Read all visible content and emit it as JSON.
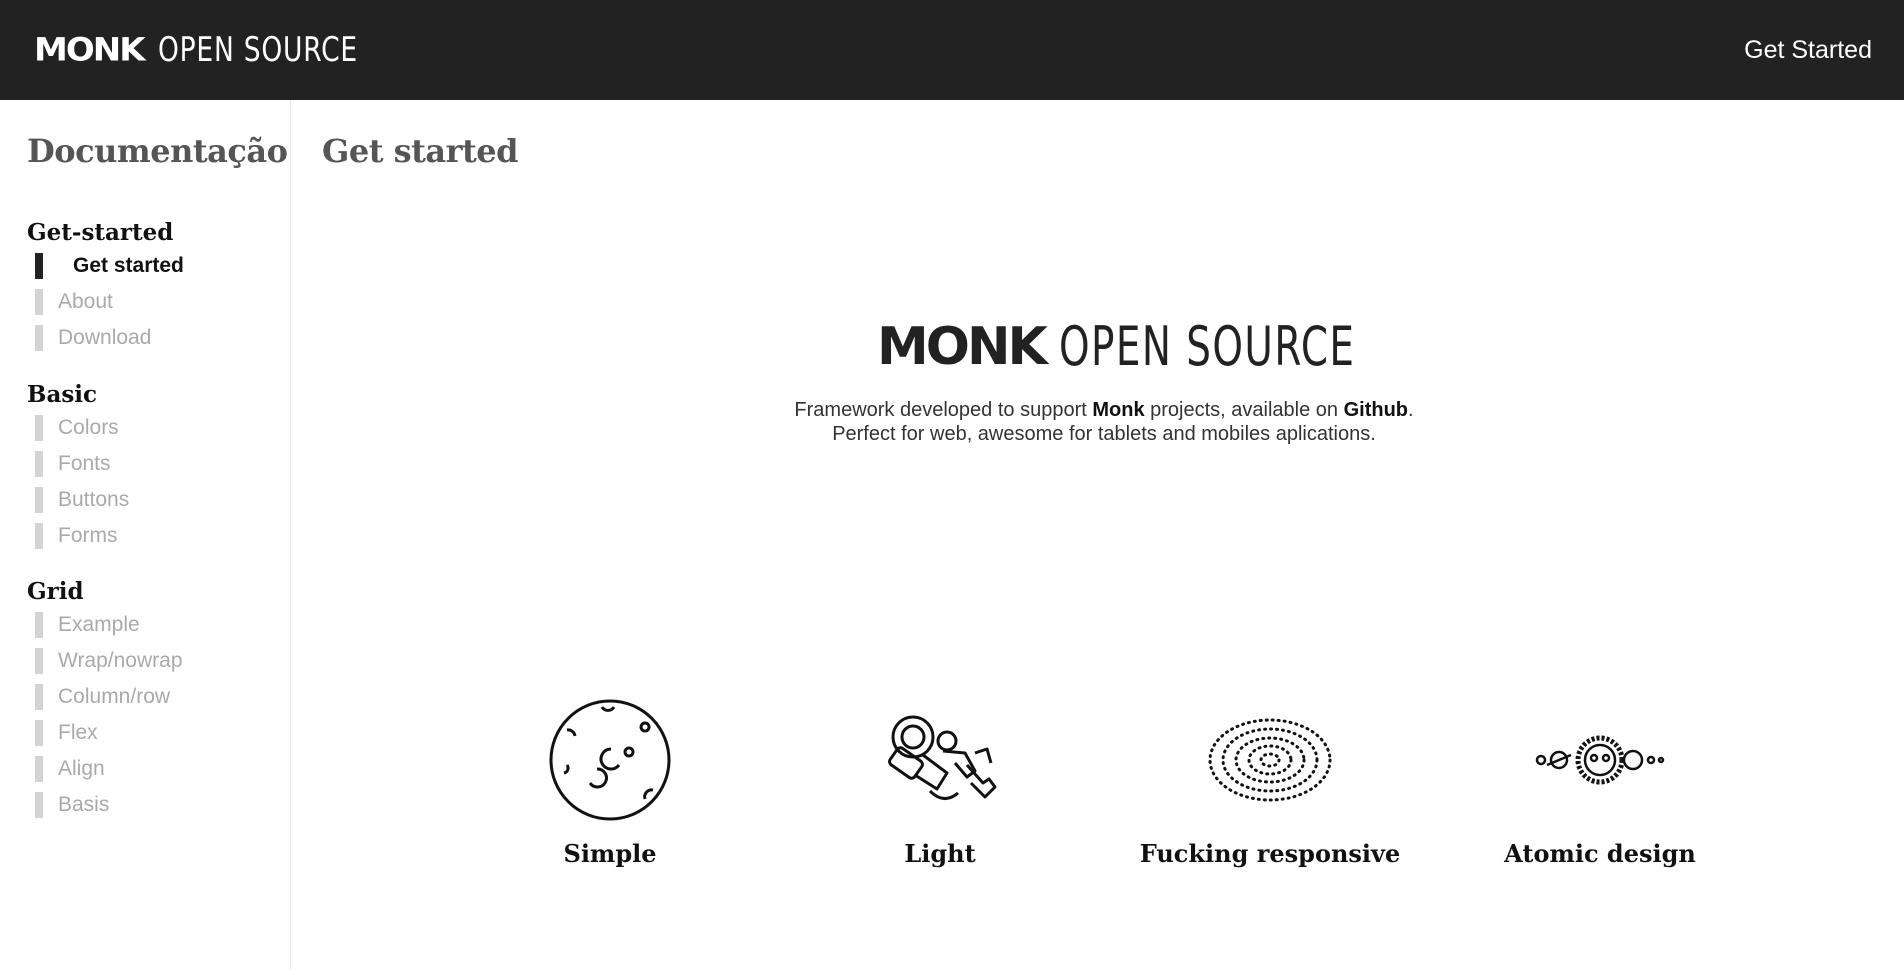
{
  "header": {
    "brand_monk": "MONK",
    "brand_open_source": "OPEN SOURCE",
    "get_started_link": "Get Started"
  },
  "sidebar": {
    "title": "Documentação",
    "groups": [
      {
        "title": "Get-started",
        "items": [
          {
            "label": "Get started",
            "active": true
          },
          {
            "label": "About"
          },
          {
            "label": "Download"
          }
        ]
      },
      {
        "title": "Basic",
        "items": [
          {
            "label": "Colors"
          },
          {
            "label": "Fonts"
          },
          {
            "label": "Buttons"
          },
          {
            "label": "Forms"
          }
        ]
      },
      {
        "title": "Grid",
        "items": [
          {
            "label": "Example"
          },
          {
            "label": "Wrap/nowrap"
          },
          {
            "label": "Column/row"
          },
          {
            "label": "Flex"
          },
          {
            "label": "Align"
          },
          {
            "label": "Basis"
          }
        ]
      }
    ]
  },
  "main": {
    "title": "Get started",
    "hero": {
      "logo_monk": "MONK",
      "logo_open_source": "OPEN SOURCE",
      "line1_prefix": "Framework developed to support ",
      "line1_bold1": "Monk",
      "line1_middle": " projects, available on ",
      "line1_bold2": "Github",
      "line1_suffix": ".",
      "line2": "Perfect for web, awesome for tablets and mobiles aplications."
    },
    "features": [
      {
        "label": "Simple",
        "icon": "moon-icon"
      },
      {
        "label": "Light",
        "icon": "astronaut-icon"
      },
      {
        "label": "Fucking responsive",
        "icon": "galaxy-icon"
      },
      {
        "label": "Atomic design",
        "icon": "solar-system-icon"
      }
    ]
  },
  "colors": {
    "topbar": "#222222",
    "active_marker": "#222222",
    "inactive_marker": "#d4d4d4",
    "inactive_text": "#aaaaaa"
  }
}
